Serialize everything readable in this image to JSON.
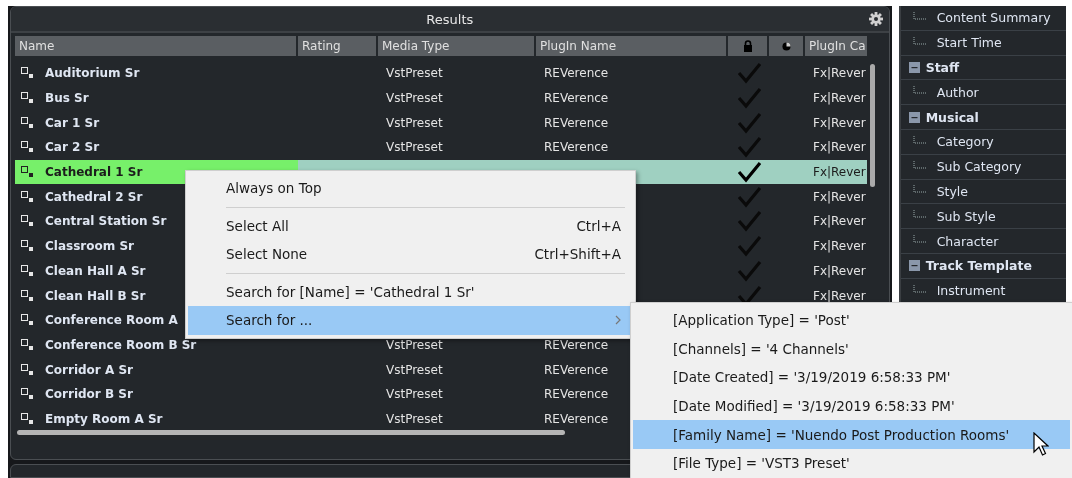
{
  "results": {
    "title": "Results",
    "columns": [
      {
        "label": "Name"
      },
      {
        "label": "Rating"
      },
      {
        "label": "Media Type"
      },
      {
        "label": "PlugIn Name"
      },
      {
        "kind": "lock"
      },
      {
        "kind": "pie"
      },
      {
        "label": "PlugIn Ca"
      }
    ],
    "rows": [
      {
        "name": "Auditorium Sr",
        "media_type": "VstPreset",
        "plugin_name": "REVerence",
        "checked": true,
        "plugin_category": "Fx|Rever",
        "selected": false
      },
      {
        "name": "Bus Sr",
        "media_type": "VstPreset",
        "plugin_name": "REVerence",
        "checked": true,
        "plugin_category": "Fx|Rever",
        "selected": false
      },
      {
        "name": "Car 1 Sr",
        "media_type": "VstPreset",
        "plugin_name": "REVerence",
        "checked": true,
        "plugin_category": "Fx|Rever",
        "selected": false
      },
      {
        "name": "Car 2 Sr",
        "media_type": "VstPreset",
        "plugin_name": "REVerence",
        "checked": true,
        "plugin_category": "Fx|Rever",
        "selected": false
      },
      {
        "name": "Cathedral 1 Sr",
        "checked": true,
        "plugin_category": "Fx|Rever",
        "selected": true
      },
      {
        "name": "Cathedral 2 Sr",
        "checked": true,
        "plugin_category": "Fx|Rever",
        "selected": false
      },
      {
        "name": "Central Station Sr",
        "checked": true,
        "plugin_category": "Fx|Rever",
        "selected": false
      },
      {
        "name": "Classroom Sr",
        "checked": true,
        "plugin_category": "Fx|Rever",
        "selected": false
      },
      {
        "name": "Clean Hall A Sr",
        "checked": true,
        "plugin_category": "Fx|Rever",
        "selected": false
      },
      {
        "name": "Clean Hall B Sr",
        "checked": true,
        "plugin_category": "Fx|Rever",
        "selected": false
      },
      {
        "name": "Conference Room A",
        "selected": false
      },
      {
        "name": "Conference Room B Sr",
        "media_type": "VstPreset",
        "plugin_name": "REVerence",
        "selected": false
      },
      {
        "name": "Corridor A Sr",
        "media_type": "VstPreset",
        "plugin_name": "REVerence",
        "selected": false
      },
      {
        "name": "Corridor B Sr",
        "media_type": "VstPreset",
        "plugin_name": "REVerence",
        "selected": false
      },
      {
        "name": "Empty Room A Sr",
        "media_type": "VstPreset",
        "plugin_name": "REVerence",
        "selected": false
      }
    ]
  },
  "tree": [
    {
      "label": "Content Summary"
    },
    {
      "label": "Start Time"
    },
    {
      "label": "Staff",
      "expanded": true,
      "children": [
        {
          "label": "Author"
        }
      ]
    },
    {
      "label": "Musical",
      "expanded": true,
      "children": [
        {
          "label": "Category"
        },
        {
          "label": "Sub Category"
        },
        {
          "label": "Style"
        },
        {
          "label": "Sub Style"
        },
        {
          "label": "Character"
        }
      ]
    },
    {
      "label": "Track Template",
      "expanded": true,
      "children": [
        {
          "label": "Instrument"
        }
      ]
    }
  ],
  "context_menu": [
    {
      "kind": "item",
      "label": "Always on Top",
      "selected": false
    },
    {
      "kind": "separator"
    },
    {
      "kind": "item",
      "label": "Select All",
      "shortcut": "Ctrl+A",
      "selected": false
    },
    {
      "kind": "item",
      "label": "Select None",
      "shortcut": "Ctrl+Shift+A",
      "selected": false
    },
    {
      "kind": "separator"
    },
    {
      "kind": "item",
      "label": "Search for [Name] = 'Cathedral 1 Sr'",
      "selected": false
    },
    {
      "kind": "submenu",
      "label": "Search for ...",
      "selected": true
    }
  ],
  "submenu": [
    {
      "label": "[Application Type] = 'Post'",
      "selected": false
    },
    {
      "label": "[Channels] = '4 Channels'",
      "selected": false
    },
    {
      "label": "[Date Created] = '3/19/2019 6:58:33 PM'",
      "selected": false
    },
    {
      "label": "[Date Modified] = '3/19/2019 6:58:33 PM'",
      "selected": false
    },
    {
      "label": "[Family Name] = 'Nuendo Post Production Rooms'",
      "selected": true
    },
    {
      "label": "[File Type] = 'VST3 Preset'",
      "selected": false
    }
  ]
}
